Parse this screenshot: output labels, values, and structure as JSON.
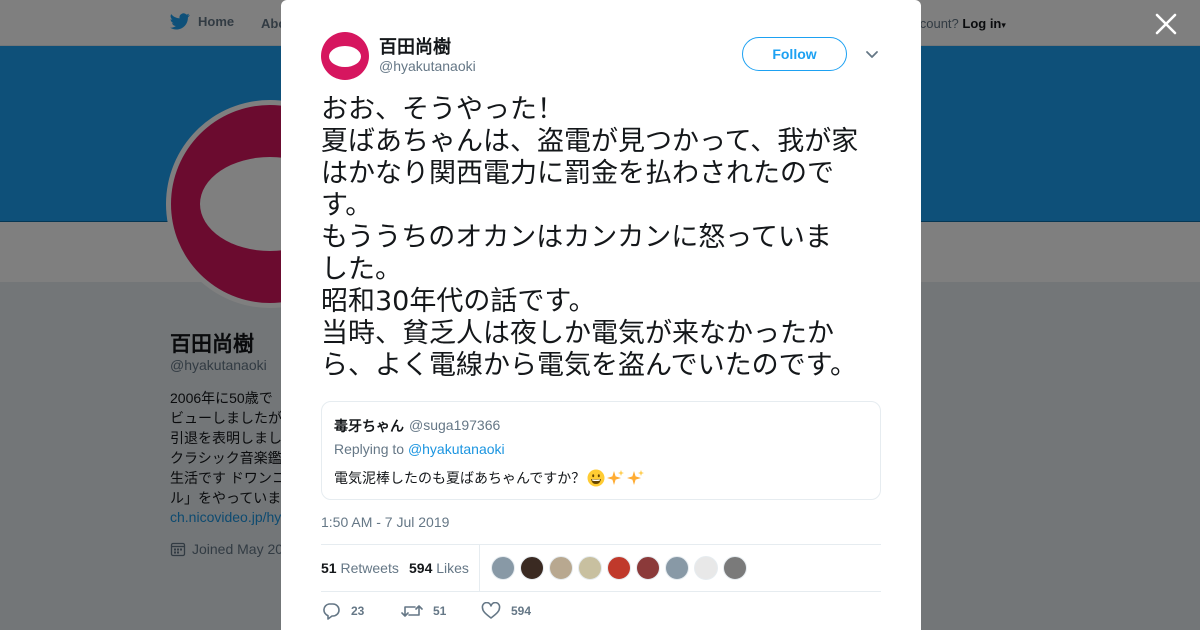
{
  "background_page": {
    "nav": {
      "home_label": "Home",
      "about_label": "Abo",
      "account_prompt": "account?",
      "login_label": "Log in"
    },
    "profile": {
      "name": "百田尚樹",
      "handle": "@hyakutanaoki",
      "bio": "2006年に50歳で\nビューしましたが\n引退を表明しまし\nクラシック音楽鑑\n生活です ドワンコ\nル」をやっていま",
      "link": "ch.nicovideo.jp/hy",
      "joined": "Joined May 20"
    },
    "colors": {
      "banner": "#1da1f2",
      "avatar": "#d6165f"
    }
  },
  "modal": {
    "close_icon": "close-icon",
    "author": {
      "name": "百田尚樹",
      "handle": "@hyakutanaoki"
    },
    "follow_label": "Follow",
    "tweet_lines": [
      "おお、そうやった！",
      "夏ばあちゃんは、盗電が見つかって、我が家",
      "はかなり関西電力に罰金を払わされたので",
      "す。",
      "もううちのオカンはカンカンに怒っていま",
      "した。",
      "昭和30年代の話です。",
      "当時、貧乏人は夜しか電気が来なかったか",
      "ら、よく電線から電気を盗んでいたのです。"
    ],
    "quoted": {
      "name": "毒牙ちゃん",
      "handle": "@suga197366",
      "replying_prefix": "Replying to",
      "replying_handle": "@hyakutanaoki",
      "text": "電気泥棒したのも夏ばあちゃんですか？",
      "emojis": [
        "grinning-face",
        "sparkles",
        "sparkles"
      ]
    },
    "timestamp": "1:50 AM - 7 Jul 2019",
    "stats": {
      "retweets_count": "51",
      "retweets_label": "Retweets",
      "likes_count": "594",
      "likes_label": "Likes"
    },
    "liker_colors": [
      "#8899a6",
      "#3a2a22",
      "#b8a890",
      "#c8c0a0",
      "#c0392b",
      "#8b3a3a",
      "#8899a6",
      "#e8e8e8",
      "#7a7a7a"
    ],
    "actions": {
      "replies": "23",
      "retweets": "51",
      "likes": "594"
    }
  }
}
